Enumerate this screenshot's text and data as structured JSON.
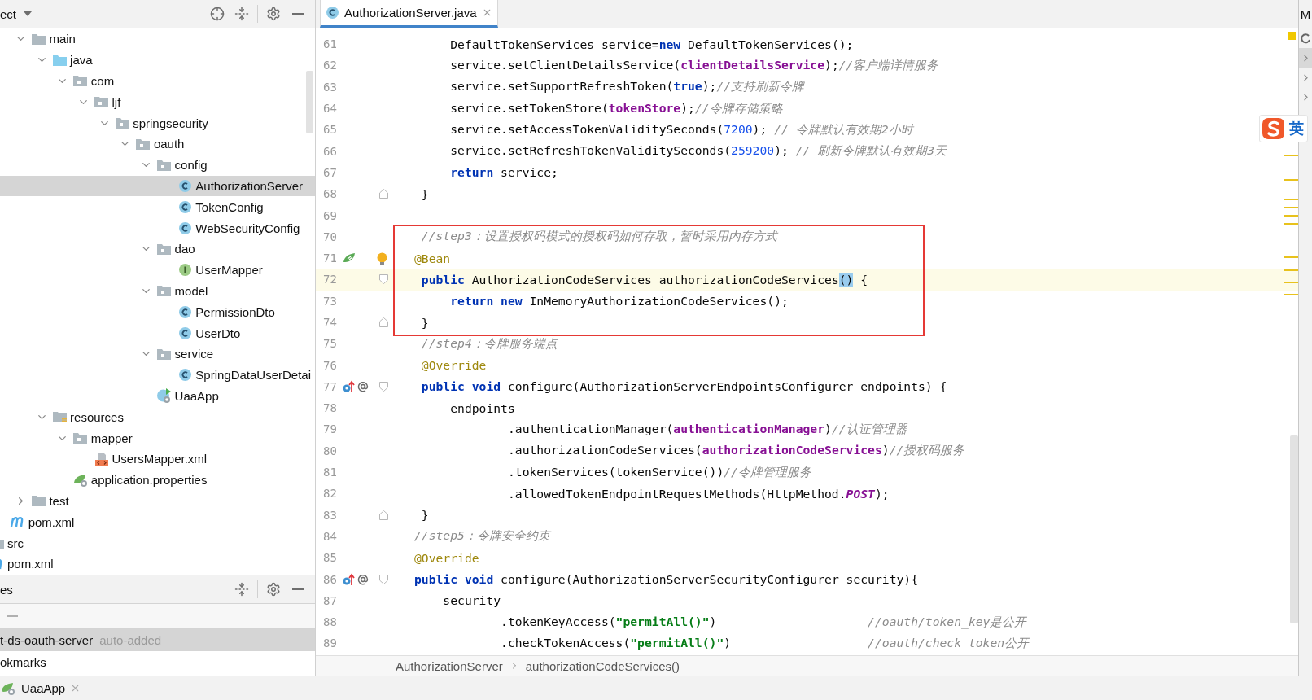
{
  "project_panel": {
    "title": "ect",
    "tree": {
      "items": [
        {
          "label": "main",
          "kind": "folder",
          "expanded": true,
          "selected": false,
          "children": [
            {
              "label": "java",
              "kind": "source-folder",
              "expanded": true,
              "selected": false,
              "children": [
                {
                  "label": "com",
                  "kind": "package",
                  "expanded": true,
                  "selected": false,
                  "children": [
                    {
                      "label": "ljf",
                      "kind": "package",
                      "expanded": true,
                      "selected": false,
                      "children": [
                        {
                          "label": "springsecurity",
                          "kind": "package",
                          "expanded": true,
                          "selected": false,
                          "children": [
                            {
                              "label": "oauth",
                              "kind": "package",
                              "expanded": true,
                              "selected": false,
                              "children": [
                                {
                                  "label": "config",
                                  "kind": "package",
                                  "expanded": true,
                                  "selected": false,
                                  "children": [
                                    {
                                      "label": "AuthorizationServer",
                                      "kind": "class",
                                      "selected": true
                                    },
                                    {
                                      "label": "TokenConfig",
                                      "kind": "class",
                                      "selected": false
                                    },
                                    {
                                      "label": "WebSecurityConfig",
                                      "kind": "class",
                                      "selected": false
                                    }
                                  ]
                                },
                                {
                                  "label": "dao",
                                  "kind": "package",
                                  "expanded": true,
                                  "selected": false,
                                  "children": [
                                    {
                                      "label": "UserMapper",
                                      "kind": "interface",
                                      "selected": false
                                    }
                                  ]
                                },
                                {
                                  "label": "model",
                                  "kind": "package",
                                  "expanded": true,
                                  "selected": false,
                                  "children": [
                                    {
                                      "label": "PermissionDto",
                                      "kind": "class",
                                      "selected": false
                                    },
                                    {
                                      "label": "UserDto",
                                      "kind": "class",
                                      "selected": false
                                    }
                                  ]
                                },
                                {
                                  "label": "service",
                                  "kind": "package",
                                  "expanded": true,
                                  "selected": false,
                                  "children": [
                                    {
                                      "label": "SpringDataUserDetai",
                                      "kind": "class",
                                      "selected": false
                                    }
                                  ]
                                },
                                {
                                  "label": "UaaApp",
                                  "kind": "app",
                                  "selected": false
                                }
                              ]
                            }
                          ]
                        }
                      ]
                    }
                  ]
                }
              ]
            },
            {
              "label": "resources",
              "kind": "resources",
              "expanded": true,
              "selected": false,
              "children": [
                {
                  "label": "mapper",
                  "kind": "package",
                  "expanded": true,
                  "selected": false,
                  "children": [
                    {
                      "label": "UsersMapper.xml",
                      "kind": "xml",
                      "selected": false
                    }
                  ]
                },
                {
                  "label": "application.properties",
                  "kind": "properties",
                  "selected": false
                }
              ]
            }
          ]
        },
        {
          "label": "test",
          "kind": "folder",
          "expanded": false,
          "selected": false
        }
      ],
      "parent_items": [
        {
          "label": "pom.xml",
          "kind": "pom",
          "selected": false
        }
      ],
      "top_items": [
        {
          "label": "src",
          "kind": "folder",
          "selected": false
        },
        {
          "label": "pom.xml",
          "kind": "pom",
          "selected": false
        }
      ]
    }
  },
  "services_panel": {
    "title": "es",
    "rows": [
      {
        "label": "t-ds-oauth-server",
        "note": "auto-added",
        "selected": true
      },
      {
        "label": "okmarks",
        "selected": false
      }
    ]
  },
  "editor": {
    "tabs": [
      {
        "label": "AuthorizationServer.java",
        "selected": true
      }
    ],
    "lines": [
      {
        "number": "61",
        "tokens": [
          {
            "kind": "plain",
            "text": "     DefaultTokenServices service="
          },
          {
            "kind": "keyword",
            "text": "new"
          },
          {
            "kind": "plain",
            "text": " DefaultTokenServices();"
          }
        ]
      },
      {
        "number": "62",
        "tokens": [
          {
            "kind": "plain",
            "text": "     service.setClientDetailsService("
          },
          {
            "kind": "field",
            "text": "clientDetailsService"
          },
          {
            "kind": "plain",
            "text": ");"
          },
          {
            "kind": "comment",
            "text": "//客户端详情服务"
          }
        ]
      },
      {
        "number": "63",
        "tokens": [
          {
            "kind": "plain",
            "text": "     service.setSupportRefreshToken("
          },
          {
            "kind": "keyword",
            "text": "true"
          },
          {
            "kind": "plain",
            "text": ");"
          },
          {
            "kind": "comment",
            "text": "//支持刷新令牌"
          }
        ]
      },
      {
        "number": "64",
        "tokens": [
          {
            "kind": "plain",
            "text": "     service.setTokenStore("
          },
          {
            "kind": "field",
            "text": "tokenStore"
          },
          {
            "kind": "plain",
            "text": ");"
          },
          {
            "kind": "comment",
            "text": "//令牌存储策略"
          }
        ]
      },
      {
        "number": "65",
        "tokens": [
          {
            "kind": "plain",
            "text": "     service.setAccessTokenValiditySeconds("
          },
          {
            "kind": "number",
            "text": "7200"
          },
          {
            "kind": "plain",
            "text": ");"
          },
          {
            "kind": "comment",
            "text": " // 令牌默认有效期2小时"
          }
        ]
      },
      {
        "number": "66",
        "tokens": [
          {
            "kind": "plain",
            "text": "     service.setRefreshTokenValiditySeconds("
          },
          {
            "kind": "number",
            "text": "259200"
          },
          {
            "kind": "plain",
            "text": ");"
          },
          {
            "kind": "comment",
            "text": " // 刷新令牌默认有效期3天"
          }
        ]
      },
      {
        "number": "67",
        "tokens": [
          {
            "kind": "keyword",
            "text": "     return"
          },
          {
            "kind": "plain",
            "text": " service;"
          }
        ]
      },
      {
        "number": "68",
        "fold": {
          "kind": "end"
        },
        "tokens": [
          {
            "kind": "plain",
            "text": " }"
          }
        ]
      },
      {
        "number": "69"
      },
      {
        "number": "70",
        "boxed": true,
        "tokens": [
          {
            "kind": "comment",
            "text": " //step3：设置授权码模式的授权码如何存取，暂时采用内存方式"
          }
        ]
      },
      {
        "number": "71",
        "boxed": true,
        "bulb": true,
        "gutter": [
          {
            "kind": "bean"
          }
        ],
        "tokens": [
          {
            "kind": "annotation",
            "text": "@Bean"
          }
        ]
      },
      {
        "number": "72",
        "boxed": true,
        "current": true,
        "fold": {
          "kind": "start"
        },
        "tokens": [
          {
            "kind": "keyword",
            "text": " public"
          },
          {
            "kind": "plain",
            "text": " AuthorizationCodeServices authorizationCodeServices"
          },
          {
            "kind": "match",
            "text": "()"
          },
          {
            "kind": "plain",
            "text": " {"
          }
        ]
      },
      {
        "number": "73",
        "boxed": true,
        "tokens": [
          {
            "kind": "keyword",
            "text": "     return"
          },
          {
            "kind": "keyword",
            "text": " new"
          },
          {
            "kind": "plain",
            "text": " InMemoryAuthorizationCodeServices();"
          }
        ]
      },
      {
        "number": "74",
        "boxed": true,
        "fold": {
          "kind": "end"
        },
        "tokens": [
          {
            "kind": "plain",
            "text": " }"
          }
        ]
      },
      {
        "number": "75",
        "tokens": [
          {
            "kind": "comment",
            "text": " //step4：令牌服务端点"
          }
        ]
      },
      {
        "number": "76",
        "tokens": [
          {
            "kind": "annotation",
            "text": " @Override"
          }
        ]
      },
      {
        "number": "77",
        "gutter": [
          {
            "kind": "override"
          },
          {
            "kind": "at"
          }
        ],
        "fold": {
          "kind": "start"
        },
        "tokens": [
          {
            "kind": "keyword",
            "text": " public"
          },
          {
            "kind": "keyword",
            "text": " void"
          },
          {
            "kind": "plain",
            "text": " configure(AuthorizationServerEndpointsConfigurer endpoints) {"
          }
        ]
      },
      {
        "number": "78",
        "tokens": [
          {
            "kind": "plain",
            "text": "     endpoints"
          }
        ]
      },
      {
        "number": "79",
        "tokens": [
          {
            "kind": "plain",
            "text": "             .authenticationManager("
          },
          {
            "kind": "field",
            "text": "authenticationManager"
          },
          {
            "kind": "plain",
            "text": ")"
          },
          {
            "kind": "comment",
            "text": "//认证管理器"
          }
        ]
      },
      {
        "number": "80",
        "tokens": [
          {
            "kind": "plain",
            "text": "             .authorizationCodeServices("
          },
          {
            "kind": "field",
            "text": "authorizationCodeServices"
          },
          {
            "kind": "plain",
            "text": ")"
          },
          {
            "kind": "comment",
            "text": "//授权码服务"
          }
        ]
      },
      {
        "number": "81",
        "tokens": [
          {
            "kind": "plain",
            "text": "             .tokenServices(tokenService())"
          },
          {
            "kind": "comment",
            "text": "//令牌管理服务"
          }
        ]
      },
      {
        "number": "82",
        "tokens": [
          {
            "kind": "plain",
            "text": "             .allowedTokenEndpointRequestMethods(HttpMethod."
          },
          {
            "kind": "static",
            "text": "POST"
          },
          {
            "kind": "plain",
            "text": ");"
          }
        ]
      },
      {
        "number": "83",
        "fold": {
          "kind": "end"
        },
        "tokens": [
          {
            "kind": "plain",
            "text": " }"
          }
        ]
      },
      {
        "number": "84",
        "tokens": [
          {
            "kind": "comment",
            "text": "//step5：令牌安全约束"
          }
        ]
      },
      {
        "number": "85",
        "tokens": [
          {
            "kind": "annotation",
            "text": "@Override"
          }
        ]
      },
      {
        "number": "86",
        "gutter": [
          {
            "kind": "override"
          },
          {
            "kind": "at"
          }
        ],
        "fold": {
          "kind": "start"
        },
        "tokens": [
          {
            "kind": "keyword",
            "text": "public"
          },
          {
            "kind": "keyword",
            "text": " void"
          },
          {
            "kind": "plain",
            "text": " configure(AuthorizationServerSecurityConfigurer security){"
          }
        ]
      },
      {
        "number": "87",
        "tokens": [
          {
            "kind": "plain",
            "text": "    security"
          }
        ]
      },
      {
        "number": "88",
        "tokens": [
          {
            "kind": "plain",
            "text": "            .tokenKeyAccess("
          },
          {
            "kind": "string",
            "text": "\"permitAll()\""
          },
          {
            "kind": "plain",
            "text": ")"
          },
          {
            "kind": "comment",
            "text": "                     //oauth/token_key是公开"
          }
        ]
      },
      {
        "number": "89",
        "tokens": [
          {
            "kind": "plain",
            "text": "            .checkTokenAccess("
          },
          {
            "kind": "string",
            "text": "\"permitAll()\""
          },
          {
            "kind": "plain",
            "text": ")"
          },
          {
            "kind": "comment",
            "text": "                   //oauth/check_token公开"
          }
        ]
      }
    ],
    "breadcrumbs": [
      "AuthorizationServer",
      "authorizationCodeServices()"
    ]
  },
  "right_panel": {
    "label": "M"
  },
  "ime_toolbar": {
    "mode": "英"
  },
  "run_bar": {
    "tab": "UaaApp"
  }
}
